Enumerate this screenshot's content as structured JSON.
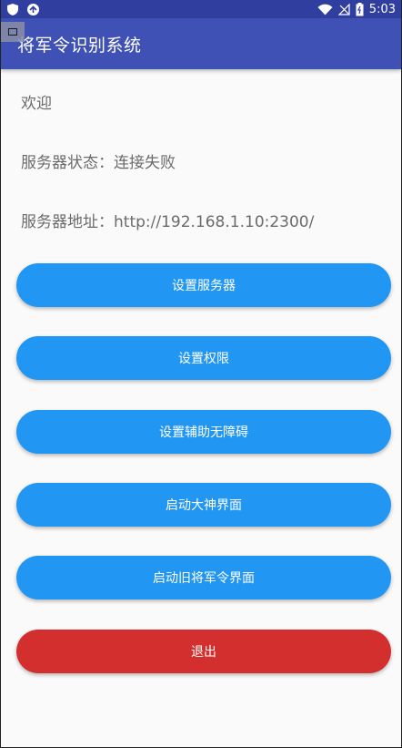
{
  "status_bar": {
    "time": "5:03",
    "icons": [
      "shield-icon",
      "vpn-icon",
      "wifi-icon",
      "no-signal-icon",
      "battery-icon"
    ],
    "color": "#303f9f"
  },
  "app_bar": {
    "title": "将军令识别系统",
    "color": "#3f51b5"
  },
  "main": {
    "welcome": "欢迎",
    "server_status": "服务器状态：连接失败",
    "server_address": "服务器地址：http://192.168.1.10:2300/",
    "buttons": [
      {
        "label": "设置服务器",
        "color": "#2196f3"
      },
      {
        "label": "设置权限",
        "color": "#2196f3"
      },
      {
        "label": "设置辅助无障碍",
        "color": "#2196f3"
      },
      {
        "label": "启动大神界面",
        "color": "#2196f3"
      },
      {
        "label": "启动旧将军令界面",
        "color": "#2196f3"
      },
      {
        "label": "退出",
        "color": "#d32f2f"
      }
    ]
  }
}
